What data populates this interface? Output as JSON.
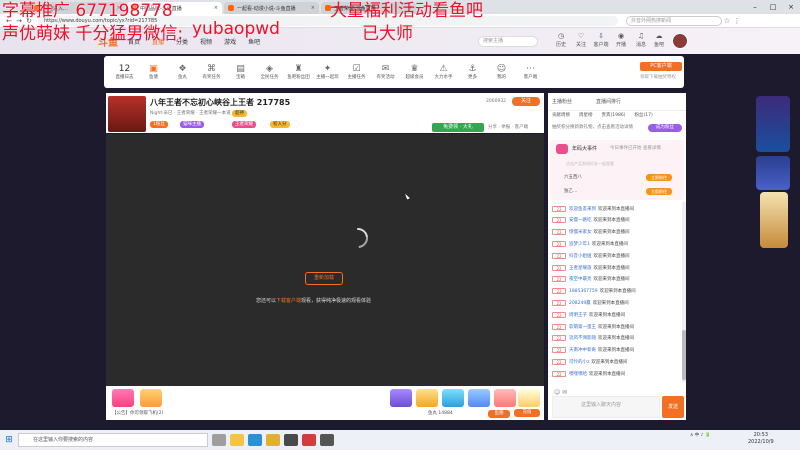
{
  "browser": {
    "tabs": [
      {
        "label": "欢迎进入…"
      },
      {
        "label": "中国品牌-斗鱼直播"
      },
      {
        "label": "一起看-动漫小说-斗鱼直播"
      },
      {
        "label": "王者荣耀-斗鱼直播"
      }
    ],
    "url": "https://www.douyu.com/topic/yx?rid=217785",
    "search_placeholder": "抖音外网热搜新闻"
  },
  "watermark": {
    "line1a": "字幕推广 677198778",
    "line1b": "大量福利活动看鱼吧",
    "line2a": "声优萌妹 千分猛男微信:",
    "line2b": "yubaopwd",
    "line2c": "已大师"
  },
  "header": {
    "logo": "斗鱼",
    "nav": [
      "首页",
      "直播",
      "分类",
      "视频",
      "游戏",
      "鱼吧"
    ],
    "search_placeholder": "搜索主播",
    "icons": [
      {
        "label": "历史",
        "icon": "clock-icon"
      },
      {
        "label": "关注",
        "icon": "heart-icon"
      },
      {
        "label": "客户端",
        "icon": "download-icon"
      },
      {
        "label": "开播",
        "icon": "camera-icon"
      },
      {
        "label": "消息",
        "icon": "bell-icon"
      },
      {
        "label": "鱼吧",
        "icon": "fish-icon"
      }
    ]
  },
  "toolbar": {
    "hot_count": "12",
    "items": [
      "直播日志",
      "鱼塘",
      "鱼丸",
      "有奖任务",
      "宝箱",
      "全民任务",
      "鱼吧粉丝团",
      "主播一起玩",
      "主播任务",
      "有奖活动",
      "超级会员",
      "大力水手",
      "更多",
      "我的",
      "客户端"
    ],
    "pc_client": "PC客户端",
    "pc_client_sub": "领取下载抽奖特权"
  },
  "stream": {
    "title": "八年王者不忘初心峡谷上王者 217785",
    "info": "Night·辛巳 · 王者荣耀 · 王者荣耀一本道",
    "rank_pill": "1粉丝",
    "tags": [
      "猫咪主播",
      "王者荣耀",
      "初入分",
      "超神"
    ],
    "follow": "关注",
    "fans": "2000932",
    "gift_strip": "免费领 · 大礼",
    "share": "分享 · 举报 · 客户端"
  },
  "player": {
    "feedback_button": "重新加载",
    "hint_prefix": "您还可以",
    "hint_link": "下载客户端",
    "hint_suffix": "观看，获得纯净极速的观看体验"
  },
  "giftbar": {
    "chat_placeholder": "【公告】你可领取飞机(2)",
    "fishball": "鱼丸 14884",
    "box_count": "鱼翅",
    "recharge": "充值"
  },
  "chat": {
    "top_tabs": [
      "主播粉丝",
      "直播间排行"
    ],
    "tabs": [
      "贡献周榜",
      "周星榜",
      "贵宾(1986)",
      "粉丝(17)"
    ],
    "notice": "抽奖积分换新款礼物，点击查看活动详情",
    "badge": "成为粉丝",
    "event_title": "年码大事件",
    "event_sub": "今日事件已开始 查看详情",
    "event_note": "点击产品发给好友一起观看",
    "event_rows": [
      {
        "label": "六五西八",
        "btn": "立即前往"
      },
      {
        "label": "独乙…",
        "btn": "立即前往"
      }
    ],
    "messages": [
      {
        "lv": "22",
        "name": "欢迎鱼友来到",
        "msg": "欢迎来到本直播间"
      },
      {
        "lv": "22",
        "name": "安慢一路吃",
        "msg": "欢迎来到本直播间"
      },
      {
        "lv": "22",
        "name": "惊慢米家女",
        "msg": "欢迎来到本直播间"
      },
      {
        "lv": "22",
        "name": "追梦少年1",
        "msg": "欢迎来到本直播间"
      },
      {
        "lv": "22",
        "name": "抖音小姐姐",
        "msg": "欢迎来到本直播间"
      },
      {
        "lv": "22",
        "name": "王者星曜旅",
        "msg": "欢迎来到本直播间"
      },
      {
        "lv": "22",
        "name": "夜空中最亮",
        "msg": "欢迎来到本直播间"
      },
      {
        "lv": "22",
        "name": "1885367759",
        "msg": "欢迎来到本直播间"
      },
      {
        "lv": "22",
        "name": "208249赢",
        "msg": "欢迎来到本直播间"
      },
      {
        "lv": "22",
        "name": "周明王子",
        "msg": "欢迎来到本直播间"
      },
      {
        "lv": "22",
        "name": "软萌第一蛋王",
        "msg": "欢迎来到本直播间"
      },
      {
        "lv": "22",
        "name": "流风不溯影随",
        "msg": "欢迎来到本直播间"
      },
      {
        "lv": "22",
        "name": "天南冲中新奇",
        "msg": "欢迎来到本直播间"
      },
      {
        "lv": "22",
        "name": "可怜的小z",
        "msg": "欢迎来到本直播间"
      },
      {
        "lv": "22",
        "name": "嘿嘿嘿哈",
        "msg": "欢迎来到本直播间"
      }
    ],
    "send_placeholder": "这里输入聊天内容",
    "send_button": "发送"
  },
  "taskbar": {
    "search": "在这里输入你要搜索的内容",
    "tray": "∧ 中 ♪ 🔋",
    "time": "20:53",
    "date": "2022/10/9"
  },
  "colors": {
    "accent": "#f36f24",
    "page_bg": "#1d1a2e",
    "watermark": "#f0102a"
  }
}
